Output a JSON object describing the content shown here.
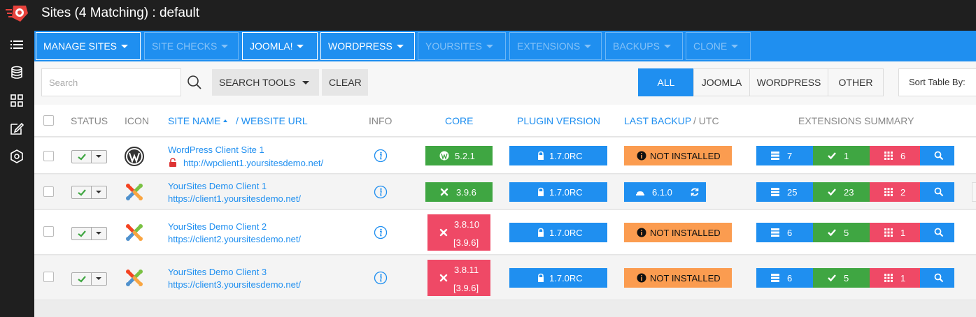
{
  "header": {
    "title": "Sites (4 Matching) : default"
  },
  "menu": [
    {
      "label": "MANAGE SITES",
      "enabled": true
    },
    {
      "label": "SITE CHECKS",
      "enabled": false
    },
    {
      "label": "JOOMLA!",
      "enabled": true
    },
    {
      "label": "WORDPRESS",
      "enabled": true
    },
    {
      "label": "YOURSITES",
      "enabled": false
    },
    {
      "label": "EXTENSIONS",
      "enabled": false
    },
    {
      "label": "BACKUPS",
      "enabled": false
    },
    {
      "label": "CLONE",
      "enabled": false
    }
  ],
  "toolbar": {
    "search_placeholder": "Search",
    "search_tools_label": "SEARCH TOOLS",
    "clear_label": "CLEAR",
    "filters": [
      "ALL",
      "JOOMLA",
      "WORDPRESS",
      "OTHER"
    ],
    "active_filter": "ALL",
    "sort_label": "Sort Table By:"
  },
  "columns": {
    "status": "STATUS",
    "icon": "ICON",
    "site_name": "SITE NAME",
    "website_url": "/ WEBSITE URL",
    "info": "INFO",
    "core": "CORE",
    "plugin_version": "PLUGIN VERSION",
    "last_backup": "LAST BACKUP",
    "utc": "/ UTC",
    "extensions_summary": "EXTENSIONS SUMMARY"
  },
  "rows": [
    {
      "site_name": "WordPress Client Site 1",
      "url": "http://wpclient1.yoursitesdemo.net/",
      "insecure": true,
      "platform": "wordpress",
      "core": "5.2.1",
      "core_expected": "",
      "core_status": "ok",
      "plugin": "1.7.0RC",
      "backup": "NOT INSTALLED",
      "ext_total": "7",
      "ext_ok": "1",
      "ext_issues": "6"
    },
    {
      "site_name": "YourSites Demo Client 1",
      "url": "https://client1.yoursitesdemo.net/",
      "insecure": false,
      "platform": "joomla",
      "core": "3.9.6",
      "core_expected": "",
      "core_status": "ok",
      "plugin": "1.7.0RC",
      "backup": "6.1.0",
      "ext_total": "25",
      "ext_ok": "23",
      "ext_issues": "2"
    },
    {
      "site_name": "YourSites Demo Client 2",
      "url": "https://client2.yoursitesdemo.net/",
      "insecure": false,
      "platform": "joomla",
      "core": "3.8.10",
      "core_expected": "[3.9.6]",
      "core_status": "outdated",
      "plugin": "1.7.0RC",
      "backup": "NOT INSTALLED",
      "ext_total": "6",
      "ext_ok": "5",
      "ext_issues": "1"
    },
    {
      "site_name": "YourSites Demo Client 3",
      "url": "https://client3.yoursitesdemo.net/",
      "insecure": false,
      "platform": "joomla",
      "core": "3.8.11",
      "core_expected": "[3.9.6]",
      "core_status": "outdated",
      "plugin": "1.7.0RC",
      "backup": "NOT INSTALLED",
      "ext_total": "6",
      "ext_ok": "5",
      "ext_issues": "1"
    }
  ],
  "colors": {
    "brand_blue": "#1f8ff0",
    "ok_green": "#3fa642",
    "alert_red": "#ef4966",
    "warn_orange": "#fb9c50",
    "dark_bg": "#1f1f1f"
  }
}
